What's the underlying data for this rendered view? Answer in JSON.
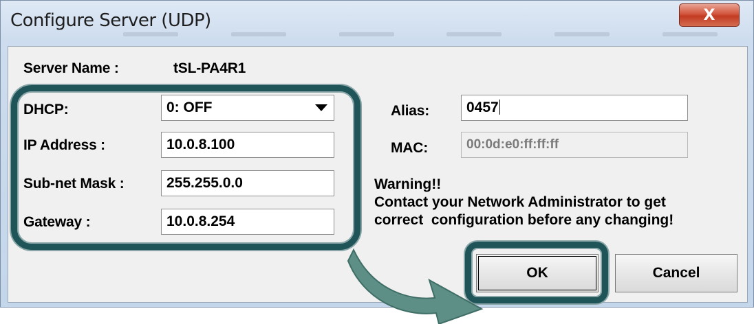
{
  "window": {
    "title": "Configure Server (UDP)",
    "close_label": "X"
  },
  "server": {
    "name_label": "Server Name :",
    "name_value": "tSL-PA4R1"
  },
  "network": {
    "dhcp_label": "DHCP:",
    "dhcp_value": "0: OFF",
    "ip_label": "IP Address :",
    "ip_value": "10.0.8.100",
    "mask_label": "Sub-net Mask :",
    "mask_value": "255.255.0.0",
    "gateway_label": "Gateway :",
    "gateway_value": "10.0.8.254"
  },
  "identity": {
    "alias_label": "Alias:",
    "alias_value": "0457",
    "mac_label": "MAC:",
    "mac_value": "00:0d:e0:ff:ff:ff"
  },
  "warning": {
    "heading": "Warning!!",
    "line1": "Contact your Network Administrator to get",
    "line2": "correct  configuration before any changing!"
  },
  "buttons": {
    "ok_label": "OK",
    "cancel_label": "Cancel"
  },
  "colors": {
    "highlight": "#1f5559",
    "arrow": "#5d8f86",
    "close_button": "#c23b22"
  },
  "icons": {
    "close": "close-icon",
    "dropdown": "chevron-down-icon",
    "callout": "curved-arrow-icon"
  }
}
